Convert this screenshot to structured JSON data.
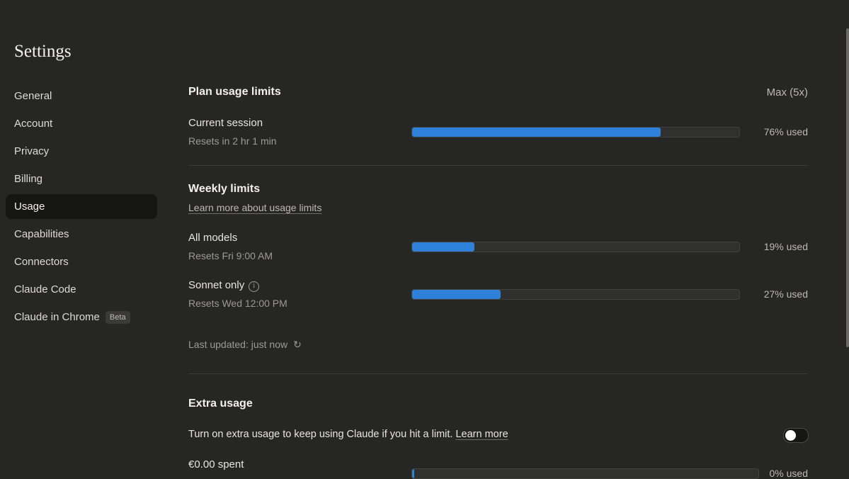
{
  "page_title": "Settings",
  "sidebar": {
    "items": [
      {
        "label": "General"
      },
      {
        "label": "Account"
      },
      {
        "label": "Privacy"
      },
      {
        "label": "Billing"
      },
      {
        "label": "Usage",
        "active": true
      },
      {
        "label": "Capabilities"
      },
      {
        "label": "Connectors"
      },
      {
        "label": "Claude Code"
      },
      {
        "label": "Claude in Chrome",
        "badge": "Beta"
      }
    ]
  },
  "plan_usage": {
    "title": "Plan usage limits",
    "plan": "Max (5x)",
    "current_session": {
      "label": "Current session",
      "reset": "Resets in 2 hr 1 min",
      "used_text": "76% used",
      "fraction": 0.76
    }
  },
  "weekly": {
    "title": "Weekly limits",
    "learn_more": "Learn more about usage limits",
    "all_models": {
      "label": "All models",
      "reset": "Resets Fri 9:00 AM",
      "used_text": "19% used",
      "fraction": 0.19
    },
    "sonnet_only": {
      "label": "Sonnet only",
      "info_icon": "info-icon",
      "reset": "Resets Wed 12:00 PM",
      "used_text": "27% used",
      "fraction": 0.27
    },
    "last_updated": "Last updated: just now",
    "refresh_icon": "refresh-icon"
  },
  "extra_usage": {
    "title": "Extra usage",
    "description": "Turn on extra usage to keep using Claude if you hit a limit.",
    "learn_more": "Learn more",
    "toggle_on": false,
    "spent_label": "€0.00 spent",
    "used_text": "0% used",
    "fraction": 0.0
  },
  "colors": {
    "background": "#262624",
    "bar_fill": "#2f80d9",
    "active_nav": "#151514"
  }
}
